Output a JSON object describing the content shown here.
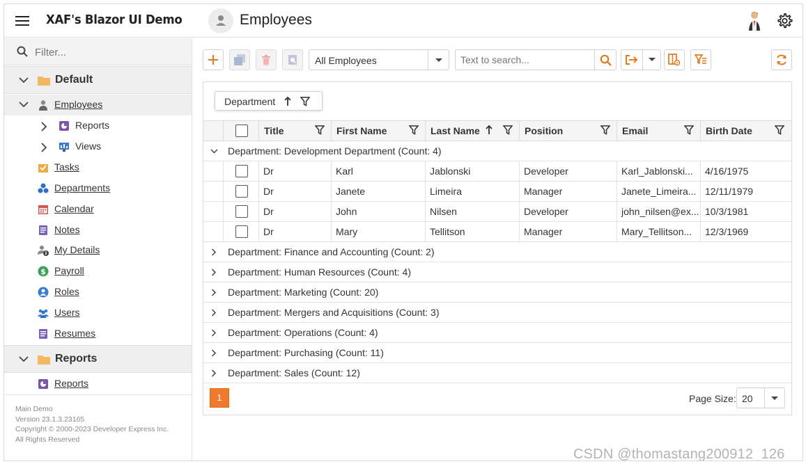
{
  "app": {
    "title": "XAF's Blazor UI Demo",
    "view_title": "Employees"
  },
  "sidebar": {
    "filter_placeholder": "Filter...",
    "groups": [
      {
        "label": "Default"
      },
      {
        "label": "Reports"
      }
    ],
    "items": {
      "employees": "Employees",
      "reports_sub": "Reports",
      "views": "Views",
      "tasks": "Tasks",
      "departments": "Departments",
      "calendar": "Calendar",
      "notes": "Notes",
      "my_details": "My Details",
      "payroll": "Payroll",
      "roles": "Roles",
      "users": "Users",
      "resumes": "Resumes",
      "reports": "Reports"
    },
    "footer": {
      "line1": "Main Demo",
      "line2": "Version 23.1.3.23165",
      "line3": "Copyright © 2000-2023 Developer Express Inc.",
      "line4": "All Rights Reserved"
    }
  },
  "toolbar": {
    "filter_select": "All Employees",
    "search_placeholder": "Text to search..."
  },
  "grid": {
    "group_by": "Department",
    "columns": [
      "Title",
      "First Name",
      "Last Name",
      "Position",
      "Email",
      "Birth Date"
    ],
    "expanded_group": "Department: Development Department (Count: 4)",
    "rows": [
      [
        "Dr",
        "Karl",
        "Jablonski",
        "Developer",
        "Karl_Jablonski...",
        "4/16/1975"
      ],
      [
        "Dr",
        "Janete",
        "Limeira",
        "Manager",
        "Janete_Limeira...",
        "12/11/1979"
      ],
      [
        "Dr",
        "John",
        "Nilsen",
        "Developer",
        "john_nilsen@ex...",
        "10/3/1981"
      ],
      [
        "Dr",
        "Mary",
        "Tellitson",
        "Manager",
        "Mary_Tellitson...",
        "12/3/1969"
      ]
    ],
    "collapsed_groups": [
      "Department: Finance and Accounting (Count: 2)",
      "Department: Human Resources (Count: 4)",
      "Department: Marketing (Count: 20)",
      "Department: Mergers and Acquisitions (Count: 3)",
      "Department: Operations (Count: 4)",
      "Department: Purchasing (Count: 11)",
      "Department: Sales (Count: 12)"
    ],
    "pager": {
      "current_page": "1",
      "page_size_label": "Page Size:",
      "page_size": "20"
    }
  },
  "colors": {
    "accent": "#e07b1f",
    "pager": "#f07a2b"
  },
  "watermark": "CSDN @thomastang200912_126"
}
